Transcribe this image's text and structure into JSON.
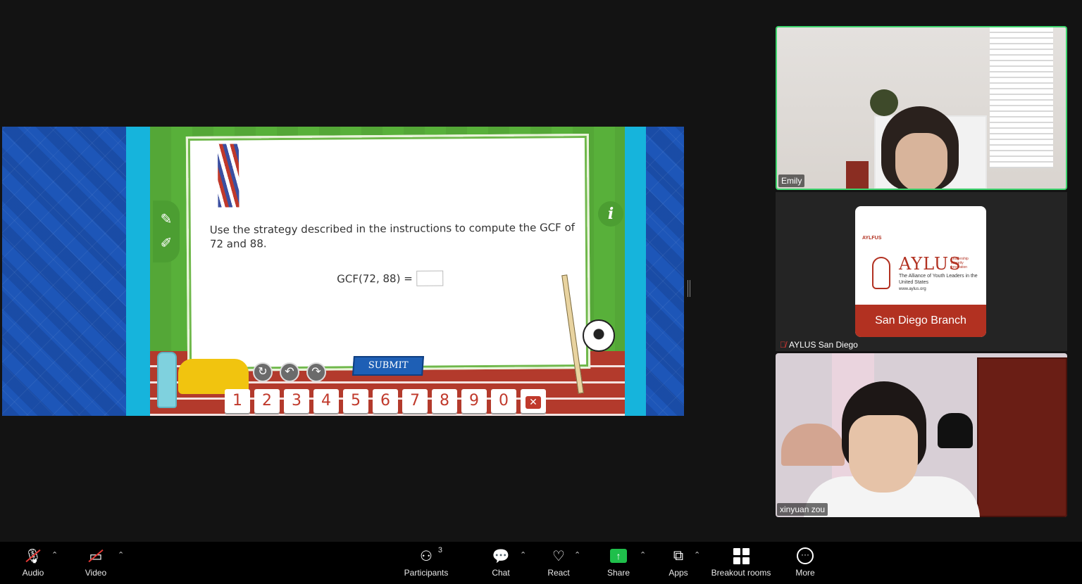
{
  "shared_screen": {
    "question": "Use the strategy described in the instructions to compute the GCF of 72 and 88.",
    "gcf_label": "GCF(72, 88) =",
    "submit_label": "SUBMIT",
    "info_label": "i",
    "keypad": [
      "1",
      "2",
      "3",
      "4",
      "5",
      "6",
      "7",
      "8",
      "9",
      "0"
    ],
    "backspace_symbol": "✕"
  },
  "participants_tiles": [
    {
      "name": "Emily",
      "active_speaker": true
    },
    {
      "name": "AYLUS San Diego",
      "muted": true
    },
    {
      "name": "xinyuan zou"
    }
  ],
  "aylus_logo": {
    "small_mark": "AYLFUS",
    "wordmark": "AYLUS",
    "motto": "Leadership\nIntegrity\nInnovation",
    "subtitle": "The Alliance of Youth Leaders in the United States",
    "url": "www.aylus.org",
    "branch": "San Diego Branch"
  },
  "toolbar": {
    "audio": "Audio",
    "video": "Video",
    "participants": "Participants",
    "participants_count": "3",
    "chat": "Chat",
    "react": "React",
    "share": "Share",
    "apps": "Apps",
    "breakout": "Breakout rooms",
    "more": "More"
  },
  "colors": {
    "active_speaker_border": "#3dd56d",
    "share_green": "#1fbf4b",
    "muted_red": "#e53935",
    "aylus_red": "#b23121"
  }
}
